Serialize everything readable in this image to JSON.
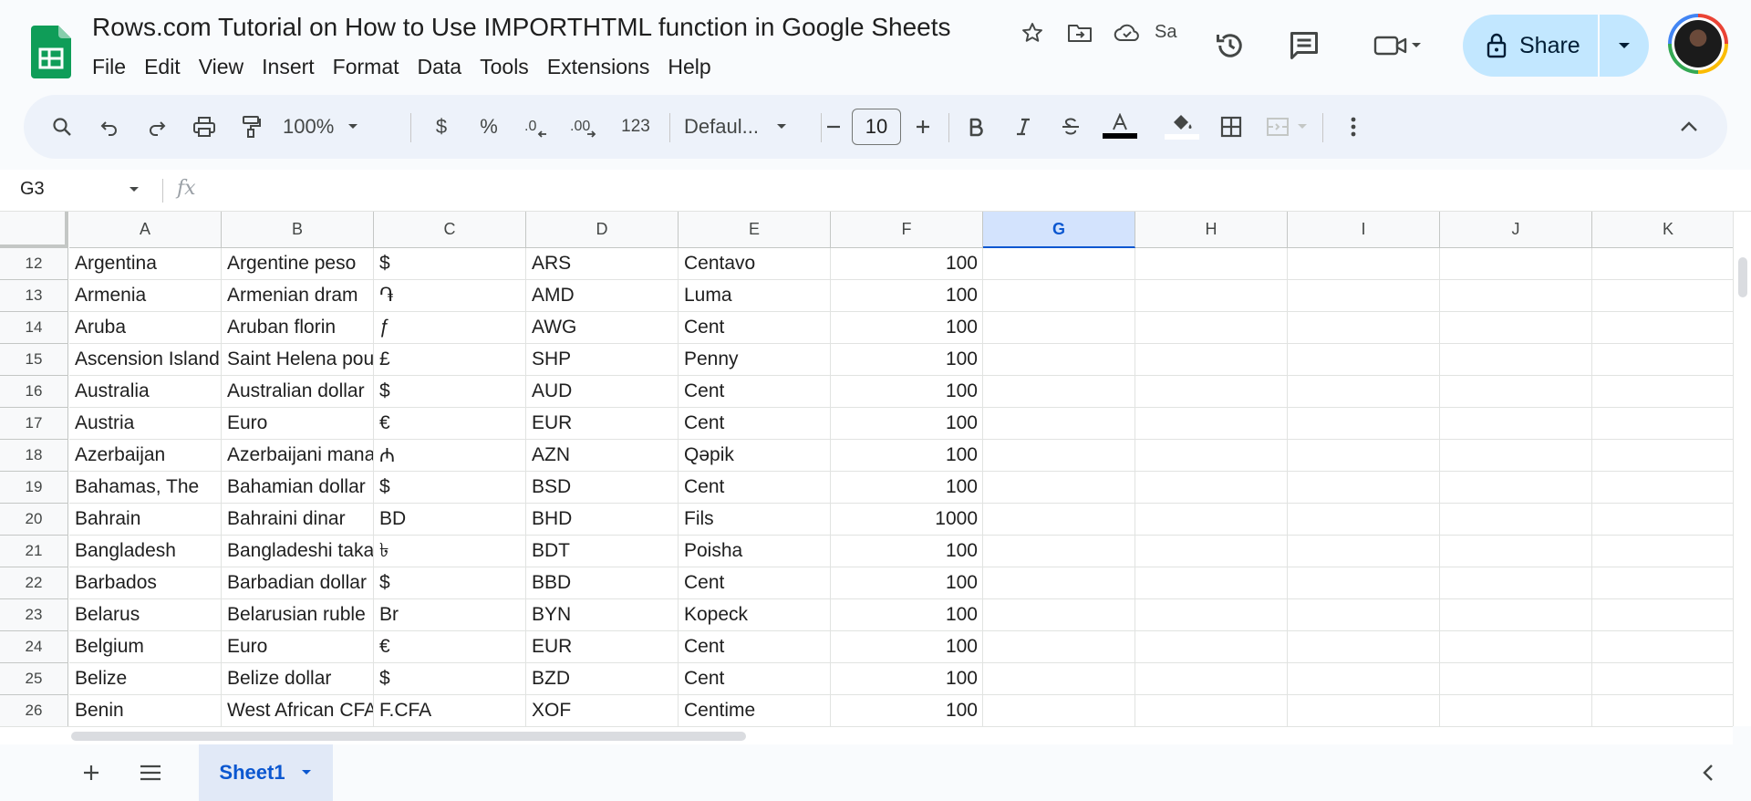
{
  "app": {
    "doc_title": "Rows.com Tutorial on How to Use IMPORTHTML function in Google Sheets",
    "saving_text": "Sa"
  },
  "menu": [
    "File",
    "Edit",
    "View",
    "Insert",
    "Format",
    "Data",
    "Tools",
    "Extensions",
    "Help"
  ],
  "share": {
    "label": "Share"
  },
  "toolbar": {
    "zoom": "100%",
    "currency": "$",
    "percent": "%",
    "number_format": "123",
    "font": "Defaul...",
    "font_size": "10"
  },
  "formula_bar": {
    "name_box": "G3",
    "fx_label": "fx",
    "value": ""
  },
  "grid": {
    "columns": [
      "A",
      "B",
      "C",
      "D",
      "E",
      "F",
      "G",
      "H",
      "I",
      "J",
      "K"
    ],
    "selected_column": "G",
    "rows": [
      {
        "n": "12",
        "cells": [
          "Argentina",
          "Argentine peso",
          "$",
          "ARS",
          "Centavo",
          "100"
        ]
      },
      {
        "n": "13",
        "cells": [
          "Armenia",
          "Armenian dram",
          "֏",
          "AMD",
          "Luma",
          "100"
        ]
      },
      {
        "n": "14",
        "cells": [
          "Aruba",
          "Aruban florin",
          "ƒ",
          "AWG",
          "Cent",
          "100"
        ]
      },
      {
        "n": "15",
        "cells": [
          "Ascension Island",
          "Saint Helena pound",
          "£",
          "SHP",
          "Penny",
          "100"
        ]
      },
      {
        "n": "16",
        "cells": [
          "Australia",
          "Australian dollar",
          "$",
          "AUD",
          "Cent",
          "100"
        ]
      },
      {
        "n": "17",
        "cells": [
          "Austria",
          "Euro",
          "€",
          "EUR",
          "Cent",
          "100"
        ]
      },
      {
        "n": "18",
        "cells": [
          "Azerbaijan",
          "Azerbaijani manat",
          "₼",
          "AZN",
          "Qəpik",
          "100"
        ]
      },
      {
        "n": "19",
        "cells": [
          "Bahamas, The",
          "Bahamian dollar",
          "$",
          "BSD",
          "Cent",
          "100"
        ]
      },
      {
        "n": "20",
        "cells": [
          "Bahrain",
          "Bahraini dinar",
          "BD",
          "BHD",
          "Fils",
          "1000"
        ]
      },
      {
        "n": "21",
        "cells": [
          "Bangladesh",
          "Bangladeshi taka",
          "৳",
          "BDT",
          "Poisha",
          "100"
        ]
      },
      {
        "n": "22",
        "cells": [
          "Barbados",
          "Barbadian dollar",
          "$",
          "BBD",
          "Cent",
          "100"
        ]
      },
      {
        "n": "23",
        "cells": [
          "Belarus",
          "Belarusian ruble",
          "Br",
          "BYN",
          "Kopeck",
          "100"
        ]
      },
      {
        "n": "24",
        "cells": [
          "Belgium",
          "Euro",
          "€",
          "EUR",
          "Cent",
          "100"
        ]
      },
      {
        "n": "25",
        "cells": [
          "Belize",
          "Belize dollar",
          "$",
          "BZD",
          "Cent",
          "100"
        ]
      },
      {
        "n": "26",
        "cells": [
          "Benin",
          "West African CFA franc",
          "F.CFA",
          "XOF",
          "Centime",
          "100"
        ]
      }
    ]
  },
  "sheets": {
    "active": "Sheet1"
  },
  "colors": {
    "accent": "#0b57d0",
    "share_bg": "#c2e7ff",
    "sheets_green": "#0f9d58",
    "toolbar_bg": "#edf2fa"
  }
}
